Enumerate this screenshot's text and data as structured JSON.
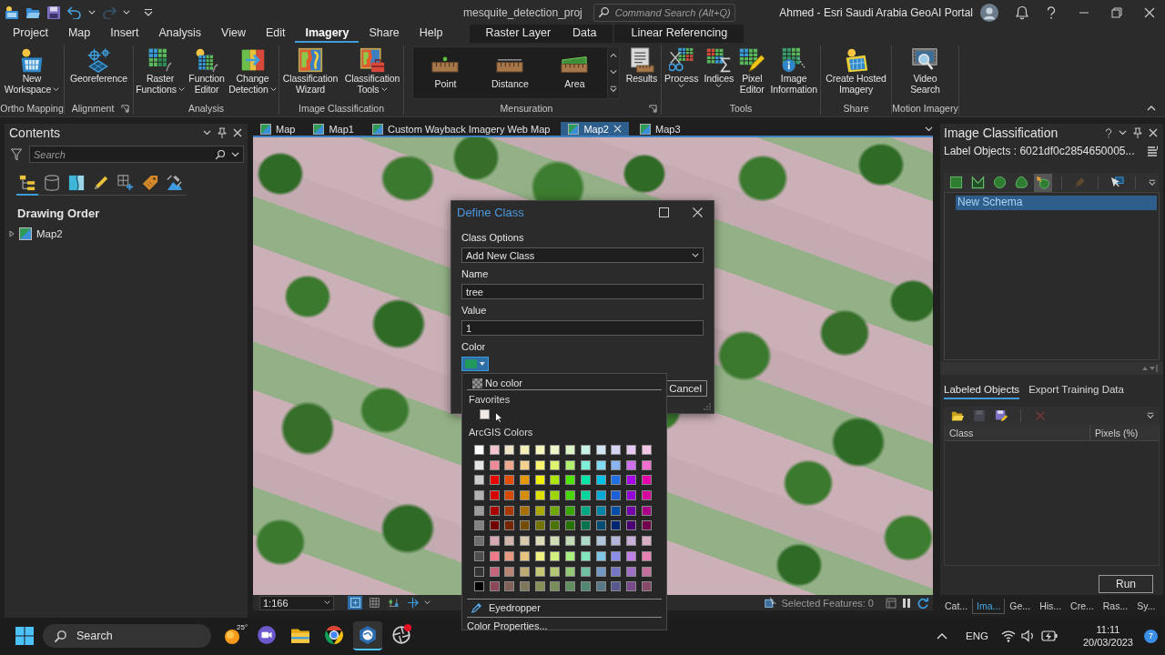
{
  "title_bar": {
    "undo": {
      "disabled": false
    },
    "redo": {
      "disabled": true
    },
    "project": "mesquite_detection_proj",
    "command_search": {
      "placeholder": "Command Search (Alt+Q)"
    },
    "user": "Ahmed - Esri Saudi Arabia GeoAI Portal"
  },
  "ribbon": {
    "tabs": [
      {
        "label": "Project",
        "selected": false
      },
      {
        "label": "Map",
        "selected": false
      },
      {
        "label": "Insert",
        "selected": false
      },
      {
        "label": "Analysis",
        "selected": false
      },
      {
        "label": "View",
        "selected": false
      },
      {
        "label": "Edit",
        "selected": false
      },
      {
        "label": "Imagery",
        "selected": true
      },
      {
        "label": "Share",
        "selected": false
      },
      {
        "label": "Help",
        "selected": false
      }
    ],
    "contextual_tabs": [
      {
        "tabs": [
          {
            "label": "Raster Layer",
            "selected": false
          },
          {
            "label": "Data",
            "selected": false
          }
        ]
      },
      {
        "tabs": [
          {
            "label": "Linear Referencing",
            "selected": false
          }
        ]
      }
    ],
    "groups": [
      {
        "label": "Ortho Mapping",
        "launcher": false,
        "buttons": [
          {
            "lines": [
              "New",
              "Workspace"
            ],
            "dropdown": true
          }
        ]
      },
      {
        "label": "Alignment",
        "launcher": true,
        "buttons": [
          {
            "lines": [
              "Georeference"
            ],
            "dropdown": false
          }
        ]
      },
      {
        "label": "Analysis",
        "launcher": false,
        "buttons": [
          {
            "lines": [
              "Raster",
              "Functions"
            ],
            "dropdown": true
          },
          {
            "lines": [
              "Function",
              "Editor"
            ],
            "dropdown": false
          },
          {
            "lines": [
              "Change",
              "Detection"
            ],
            "dropdown": true
          }
        ]
      },
      {
        "label": "Image Classification",
        "launcher": false,
        "buttons": [
          {
            "lines": [
              "Classification",
              "Wizard"
            ],
            "dropdown": false
          },
          {
            "lines": [
              "Classification",
              "Tools"
            ],
            "dropdown": true
          }
        ]
      },
      {
        "label": "Mensuration",
        "launcher": true,
        "gallery": [
          {
            "label": "Point"
          },
          {
            "label": "Distance"
          },
          {
            "label": "Area"
          }
        ],
        "buttons": [
          {
            "lines": [
              "Results"
            ],
            "dropdown": false
          }
        ]
      },
      {
        "label": "Tools",
        "launcher": false,
        "buttons": [
          {
            "lines": [
              "Process"
            ],
            "dropdown": true
          },
          {
            "lines": [
              "Indices"
            ],
            "dropdown": true
          },
          {
            "lines": [
              "Pixel",
              "Editor"
            ],
            "dropdown": false
          },
          {
            "lines": [
              "Image",
              "Information"
            ],
            "dropdown": false
          }
        ]
      },
      {
        "label": "Share",
        "launcher": false,
        "buttons": [
          {
            "lines": [
              "Create Hosted",
              "Imagery"
            ],
            "dropdown": false
          }
        ]
      },
      {
        "label": "Motion Imagery",
        "launcher": false,
        "buttons": [
          {
            "lines": [
              "Video",
              "Search"
            ],
            "dropdown": false
          }
        ]
      }
    ]
  },
  "contents_pane": {
    "title": "Contents",
    "search": {
      "placeholder": "Search"
    },
    "view_tabs": [
      {
        "selected": true
      },
      {
        "selected": false
      },
      {
        "selected": false
      },
      {
        "selected": false
      },
      {
        "selected": false
      },
      {
        "selected": false
      },
      {
        "selected": false
      }
    ],
    "heading": "Drawing Order",
    "tree": [
      {
        "label": "Map2",
        "expanded": false
      }
    ]
  },
  "map_view": {
    "tabs": [
      {
        "label": "Map",
        "selected": false
      },
      {
        "label": "Map1",
        "selected": false
      },
      {
        "label": "Custom Wayback Imagery Web Map",
        "selected": false
      },
      {
        "label": "Map2",
        "selected": true
      },
      {
        "label": "Map3",
        "selected": false
      }
    ],
    "status_bar": {
      "scale": "1:166",
      "tools": [
        {
          "on": true
        },
        {
          "on": false
        },
        {
          "on": false
        },
        {
          "on": false
        }
      ],
      "selected_features": "Selected Features: 0"
    }
  },
  "dialog": {
    "title": "Define Class",
    "fields": [
      {
        "label": "Class Options",
        "kind": "dropdown",
        "value": "Add New Class"
      },
      {
        "label": "Name",
        "kind": "text",
        "value": "tree"
      },
      {
        "label": "Value",
        "kind": "text",
        "value": "1"
      },
      {
        "label": "Color",
        "kind": "color",
        "color": "#1f9a5a",
        "expanded": true
      }
    ],
    "buttons": [
      {
        "label": "Cancel"
      }
    ]
  },
  "color_menu": {
    "no_color": "No color",
    "favorites_label": "Favorites",
    "favorites": [
      {
        "color": "#efebe4"
      }
    ],
    "palette_label": "ArcGIS Colors",
    "palette": [
      {
        "color": "#ffffff"
      },
      {
        "color": "#f2c4d0"
      },
      {
        "color": "#efe4c8"
      },
      {
        "color": "#f3efb8"
      },
      {
        "color": "#f7f6bc"
      },
      {
        "color": "#eef5c8"
      },
      {
        "color": "#def5c8"
      },
      {
        "color": "#c8f2e8"
      },
      {
        "color": "#cfe6f2"
      },
      {
        "color": "#d2d4f2"
      },
      {
        "color": "#e6c8f0"
      },
      {
        "color": "#f2c6e2"
      },
      {
        "color": "#e4e4e4"
      },
      {
        "color": "#ee8a9a"
      },
      {
        "color": "#eea88e"
      },
      {
        "color": "#f2d08e"
      },
      {
        "color": "#f8f66e"
      },
      {
        "color": "#dcf46e"
      },
      {
        "color": "#b0f270"
      },
      {
        "color": "#7eeed8"
      },
      {
        "color": "#80dcf2"
      },
      {
        "color": "#88b4f2"
      },
      {
        "color": "#d06ef0"
      },
      {
        "color": "#f06ed0"
      },
      {
        "color": "#cccccc"
      },
      {
        "color": "#e60000"
      },
      {
        "color": "#e64c00"
      },
      {
        "color": "#e69800"
      },
      {
        "color": "#f0f000"
      },
      {
        "color": "#aae600"
      },
      {
        "color": "#4ce600"
      },
      {
        "color": "#00e6a8"
      },
      {
        "color": "#00c0e6"
      },
      {
        "color": "#1f6ee6"
      },
      {
        "color": "#a800e6"
      },
      {
        "color": "#e600a9"
      },
      {
        "color": "#b2b2b2"
      },
      {
        "color": "#d70000"
      },
      {
        "color": "#d64700"
      },
      {
        "color": "#d68f00"
      },
      {
        "color": "#e0e000"
      },
      {
        "color": "#9ed600"
      },
      {
        "color": "#47d600"
      },
      {
        "color": "#00d69c"
      },
      {
        "color": "#00a9d6"
      },
      {
        "color": "#1c5fd6"
      },
      {
        "color": "#9200d6"
      },
      {
        "color": "#d6009c"
      },
      {
        "color": "#9c9c9c"
      },
      {
        "color": "#a80000"
      },
      {
        "color": "#a83800"
      },
      {
        "color": "#a87000"
      },
      {
        "color": "#a8a800"
      },
      {
        "color": "#70a800"
      },
      {
        "color": "#38a800"
      },
      {
        "color": "#00a884"
      },
      {
        "color": "#0084a8"
      },
      {
        "color": "#004da8"
      },
      {
        "color": "#7300a8"
      },
      {
        "color": "#a80084"
      },
      {
        "color": "#828282"
      },
      {
        "color": "#730000"
      },
      {
        "color": "#732600"
      },
      {
        "color": "#734c00"
      },
      {
        "color": "#737300"
      },
      {
        "color": "#4c7300"
      },
      {
        "color": "#267300"
      },
      {
        "color": "#00734c"
      },
      {
        "color": "#004c73"
      },
      {
        "color": "#002673"
      },
      {
        "color": "#4c0073"
      },
      {
        "color": "#73004c"
      },
      {
        "color": "#6e6e6e"
      },
      {
        "color": "#d6a8b4"
      },
      {
        "color": "#d2b5ac"
      },
      {
        "color": "#d6c9ae"
      },
      {
        "color": "#dcdcb6"
      },
      {
        "color": "#cfdcb4"
      },
      {
        "color": "#c2dbb6"
      },
      {
        "color": "#addbc8"
      },
      {
        "color": "#b0c6da"
      },
      {
        "color": "#b4b6da"
      },
      {
        "color": "#c6aed8"
      },
      {
        "color": "#d8aec4"
      },
      {
        "color": "#4e4e4e"
      },
      {
        "color": "#f07a8a"
      },
      {
        "color": "#e69880"
      },
      {
        "color": "#e6c480"
      },
      {
        "color": "#f0f080"
      },
      {
        "color": "#d2f080"
      },
      {
        "color": "#a8f080"
      },
      {
        "color": "#80e6bc"
      },
      {
        "color": "#80c4e6"
      },
      {
        "color": "#8a8ee6"
      },
      {
        "color": "#c080e6"
      },
      {
        "color": "#e680b4"
      },
      {
        "color": "#343434"
      },
      {
        "color": "#c4647a"
      },
      {
        "color": "#b88474"
      },
      {
        "color": "#c0aa74"
      },
      {
        "color": "#c8c874"
      },
      {
        "color": "#b4c874"
      },
      {
        "color": "#94c874"
      },
      {
        "color": "#70c0a0"
      },
      {
        "color": "#7098c0"
      },
      {
        "color": "#7478c4"
      },
      {
        "color": "#a070c4"
      },
      {
        "color": "#c4709c"
      },
      {
        "color": "#000000"
      },
      {
        "color": "#8c4858"
      },
      {
        "color": "#806058"
      },
      {
        "color": "#80785a"
      },
      {
        "color": "#889058"
      },
      {
        "color": "#789058"
      },
      {
        "color": "#609060"
      },
      {
        "color": "#508870"
      },
      {
        "color": "#587888"
      },
      {
        "color": "#585890"
      },
      {
        "color": "#784888"
      },
      {
        "color": "#884868"
      }
    ],
    "eyedropper": "Eyedropper",
    "properties": "Color Properties..."
  },
  "image_classification": {
    "title": "Image Classification",
    "label_objects": "Label Objects : 6021df0c2854650005...",
    "tools": [
      {
        "selected": false,
        "disabled": false
      },
      {
        "selected": false,
        "disabled": false
      },
      {
        "selected": false,
        "disabled": false
      },
      {
        "selected": false,
        "disabled": false
      },
      {
        "selected": true,
        "disabled": false
      },
      {
        "selected": false,
        "disabled": true
      },
      {
        "selected": false,
        "disabled": false
      }
    ],
    "schema": [
      {
        "label": "New Schema",
        "selected": true
      }
    ],
    "tabs": [
      {
        "label": "Labeled Objects",
        "selected": true
      },
      {
        "label": "Export Training Data",
        "selected": false
      }
    ],
    "table_tools": [
      {
        "disabled": false
      },
      {
        "disabled": true
      },
      {
        "disabled": false
      },
      {
        "disabled": true
      }
    ],
    "columns": [
      "Class",
      "Pixels (%)"
    ],
    "run_button": "Run"
  },
  "dock_tabs": [
    {
      "label": "Cat...",
      "selected": false
    },
    {
      "label": "Ima...",
      "selected": true
    },
    {
      "label": "Ge...",
      "selected": false
    },
    {
      "label": "His...",
      "selected": false
    },
    {
      "label": "Cre...",
      "selected": false
    },
    {
      "label": "Ras...",
      "selected": false
    },
    {
      "label": "Sy...",
      "selected": false
    }
  ],
  "taskbar": {
    "search": {
      "placeholder": "Search"
    },
    "weather": "25°",
    "apps": [
      {
        "active": false,
        "badge": false
      },
      {
        "active": false,
        "badge": false
      },
      {
        "active": false,
        "badge": false
      },
      {
        "active": true,
        "badge": false
      },
      {
        "active": false,
        "badge": true
      }
    ],
    "language": "ENG",
    "time": "11:11",
    "date": "20/03/2023",
    "notifications": "7"
  }
}
